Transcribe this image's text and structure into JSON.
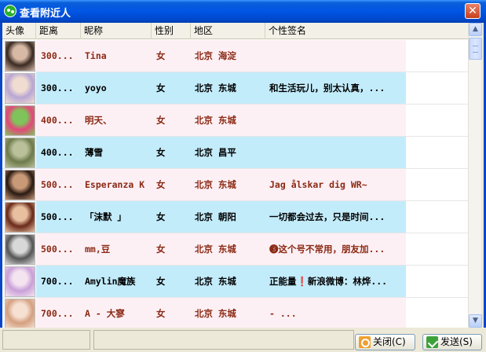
{
  "window": {
    "title": "查看附近人",
    "close_glyph": "✕"
  },
  "columns": [
    "头像",
    "距离",
    "昵称",
    "性别",
    "地区",
    "个性签名"
  ],
  "rows": [
    {
      "distance": "300...",
      "nickname": "Tina",
      "gender": "女",
      "area": "北京 海淀",
      "signature": "",
      "bg": "pink",
      "text_color": "#8b2a14",
      "avatar": {
        "c1": "#3a2a22",
        "c2": "#d7b9a5"
      }
    },
    {
      "distance": "300...",
      "nickname": "  yoyo",
      "gender": "女",
      "area": "北京 东城",
      "signature": "和生活玩儿，别太认真，...",
      "bg": "blue",
      "text_color": "#000000",
      "avatar": {
        "c1": "#b8a6d4",
        "c2": "#f0dcd0"
      }
    },
    {
      "distance": "400...",
      "nickname": "明天、",
      "gender": "女",
      "area": "北京 东城",
      "signature": "",
      "bg": "pink",
      "text_color": "#8b2a14",
      "avatar": {
        "c1": "#e3477a",
        "c2": "#7fc45a"
      }
    },
    {
      "distance": "400...",
      "nickname": "薄雪",
      "gender": "女",
      "area": "北京 昌平",
      "signature": "",
      "bg": "blue",
      "text_color": "#000000",
      "avatar": {
        "c1": "#6d7a4a",
        "c2": "#b9c09a"
      }
    },
    {
      "distance": "500...",
      "nickname": "Esperanza K",
      "gender": "女",
      "area": "北京 东城",
      "signature": "Jag ålskar dig WR~",
      "bg": "pink",
      "text_color": "#8b2a14",
      "avatar": {
        "c1": "#2a1a12",
        "c2": "#c99a78"
      }
    },
    {
      "distance": "500...",
      "nickname": "「沫默  」",
      "gender": "女",
      "area": "北京 朝阳",
      "signature": "一切都会过去，只是时间...",
      "bg": "blue",
      "text_color": "#000000",
      "avatar": {
        "c1": "#6a2a1a",
        "c2": "#e8c0a0"
      }
    },
    {
      "distance": "500...",
      "nickname": "mm,豆",
      "gender": "女",
      "area": "北京 东城",
      "signature": "❸这个号不常用，朋友加...",
      "bg": "pink",
      "text_color": "#8b2a14",
      "avatar": {
        "c1": "#555555",
        "c2": "#d8d8d8"
      }
    },
    {
      "distance": "700...",
      "nickname": "Amylin魔族",
      "gender": "女",
      "area": "北京 东城",
      "signature": "正能量❗新浪微博：林烨...",
      "bg": "blue",
      "text_color": "#000000",
      "avatar": {
        "c1": "#c9a0d8",
        "c2": "#f4e4f0"
      }
    },
    {
      "distance": "700...",
      "nickname": "A  -  大寥",
      "gender": "女",
      "area": "北京 东城",
      "signature": "-            ...",
      "bg": "pink",
      "text_color": "#8b2a14",
      "avatar": {
        "c1": "#d4a080",
        "c2": "#f6e0d2"
      }
    }
  ],
  "scrollbar": {
    "up_icon": "▲",
    "down_icon": "▼"
  },
  "buttons": {
    "close": "关闭(C)",
    "send": "发送(S)"
  }
}
